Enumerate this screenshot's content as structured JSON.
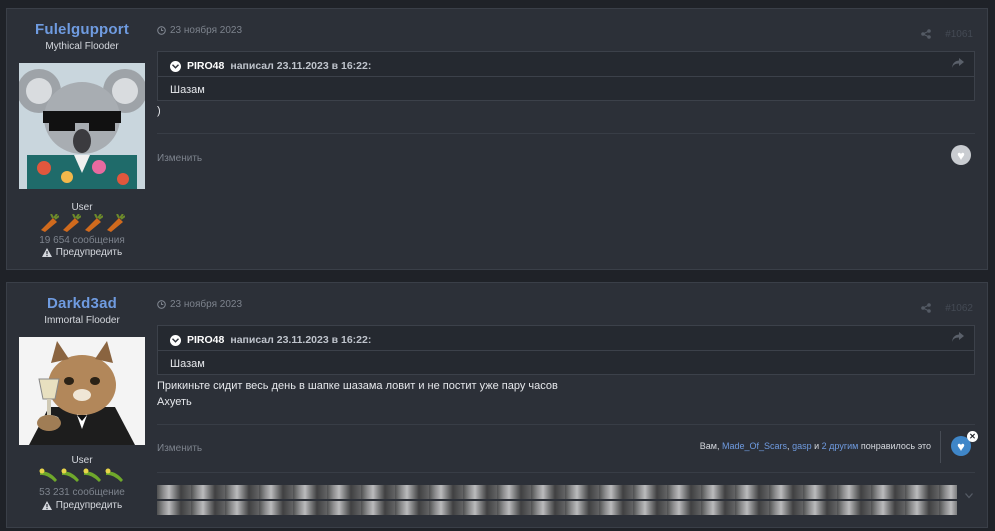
{
  "posts": [
    {
      "author": {
        "name": "Fulelgupport",
        "title": "Mythical Flooder",
        "group": "User",
        "post_count": "19 654 сообщения",
        "warn": "Предупредить"
      },
      "date": "23 ноября 2023",
      "post_number": "#1061",
      "quote": {
        "author": "PIRO48",
        "wrote": "написал 23.11.2023 в 16:22:",
        "text": "Шазам"
      },
      "body": [
        ")"
      ],
      "edit": "Изменить"
    },
    {
      "author": {
        "name": "Darkd3ad",
        "title": "Immortal Flooder",
        "group": "User",
        "post_count": "53 231 сообщение",
        "warn": "Предупредить"
      },
      "date": "23 ноября 2023",
      "post_number": "#1062",
      "quote": {
        "author": "PIRO48",
        "wrote": "написал 23.11.2023 в 16:22:",
        "text": "Шазам"
      },
      "body": [
        "Прикиньте сидит весь день в шапке шазама ловит и не постит уже пару часов",
        "Ахуеть"
      ],
      "edit": "Изменить",
      "reactions": {
        "prefix": "Вам,",
        "user1": "Made_Of_Scars",
        "comma": ",",
        "user2": "gasp",
        "and": "и",
        "others": "2 другим",
        "suffix": "понравилось это"
      }
    }
  ],
  "icons": {
    "clock": "clock-icon",
    "share": "share-icon",
    "warning": "warning-icon",
    "heart": "heart-icon",
    "reply": "reply-arrow-icon",
    "chevron": "chevron-down-icon"
  },
  "colors": {
    "background": "#1f2228",
    "panel": "#2c3038",
    "link": "#6f9be0",
    "like_active": "#3f86c8"
  }
}
